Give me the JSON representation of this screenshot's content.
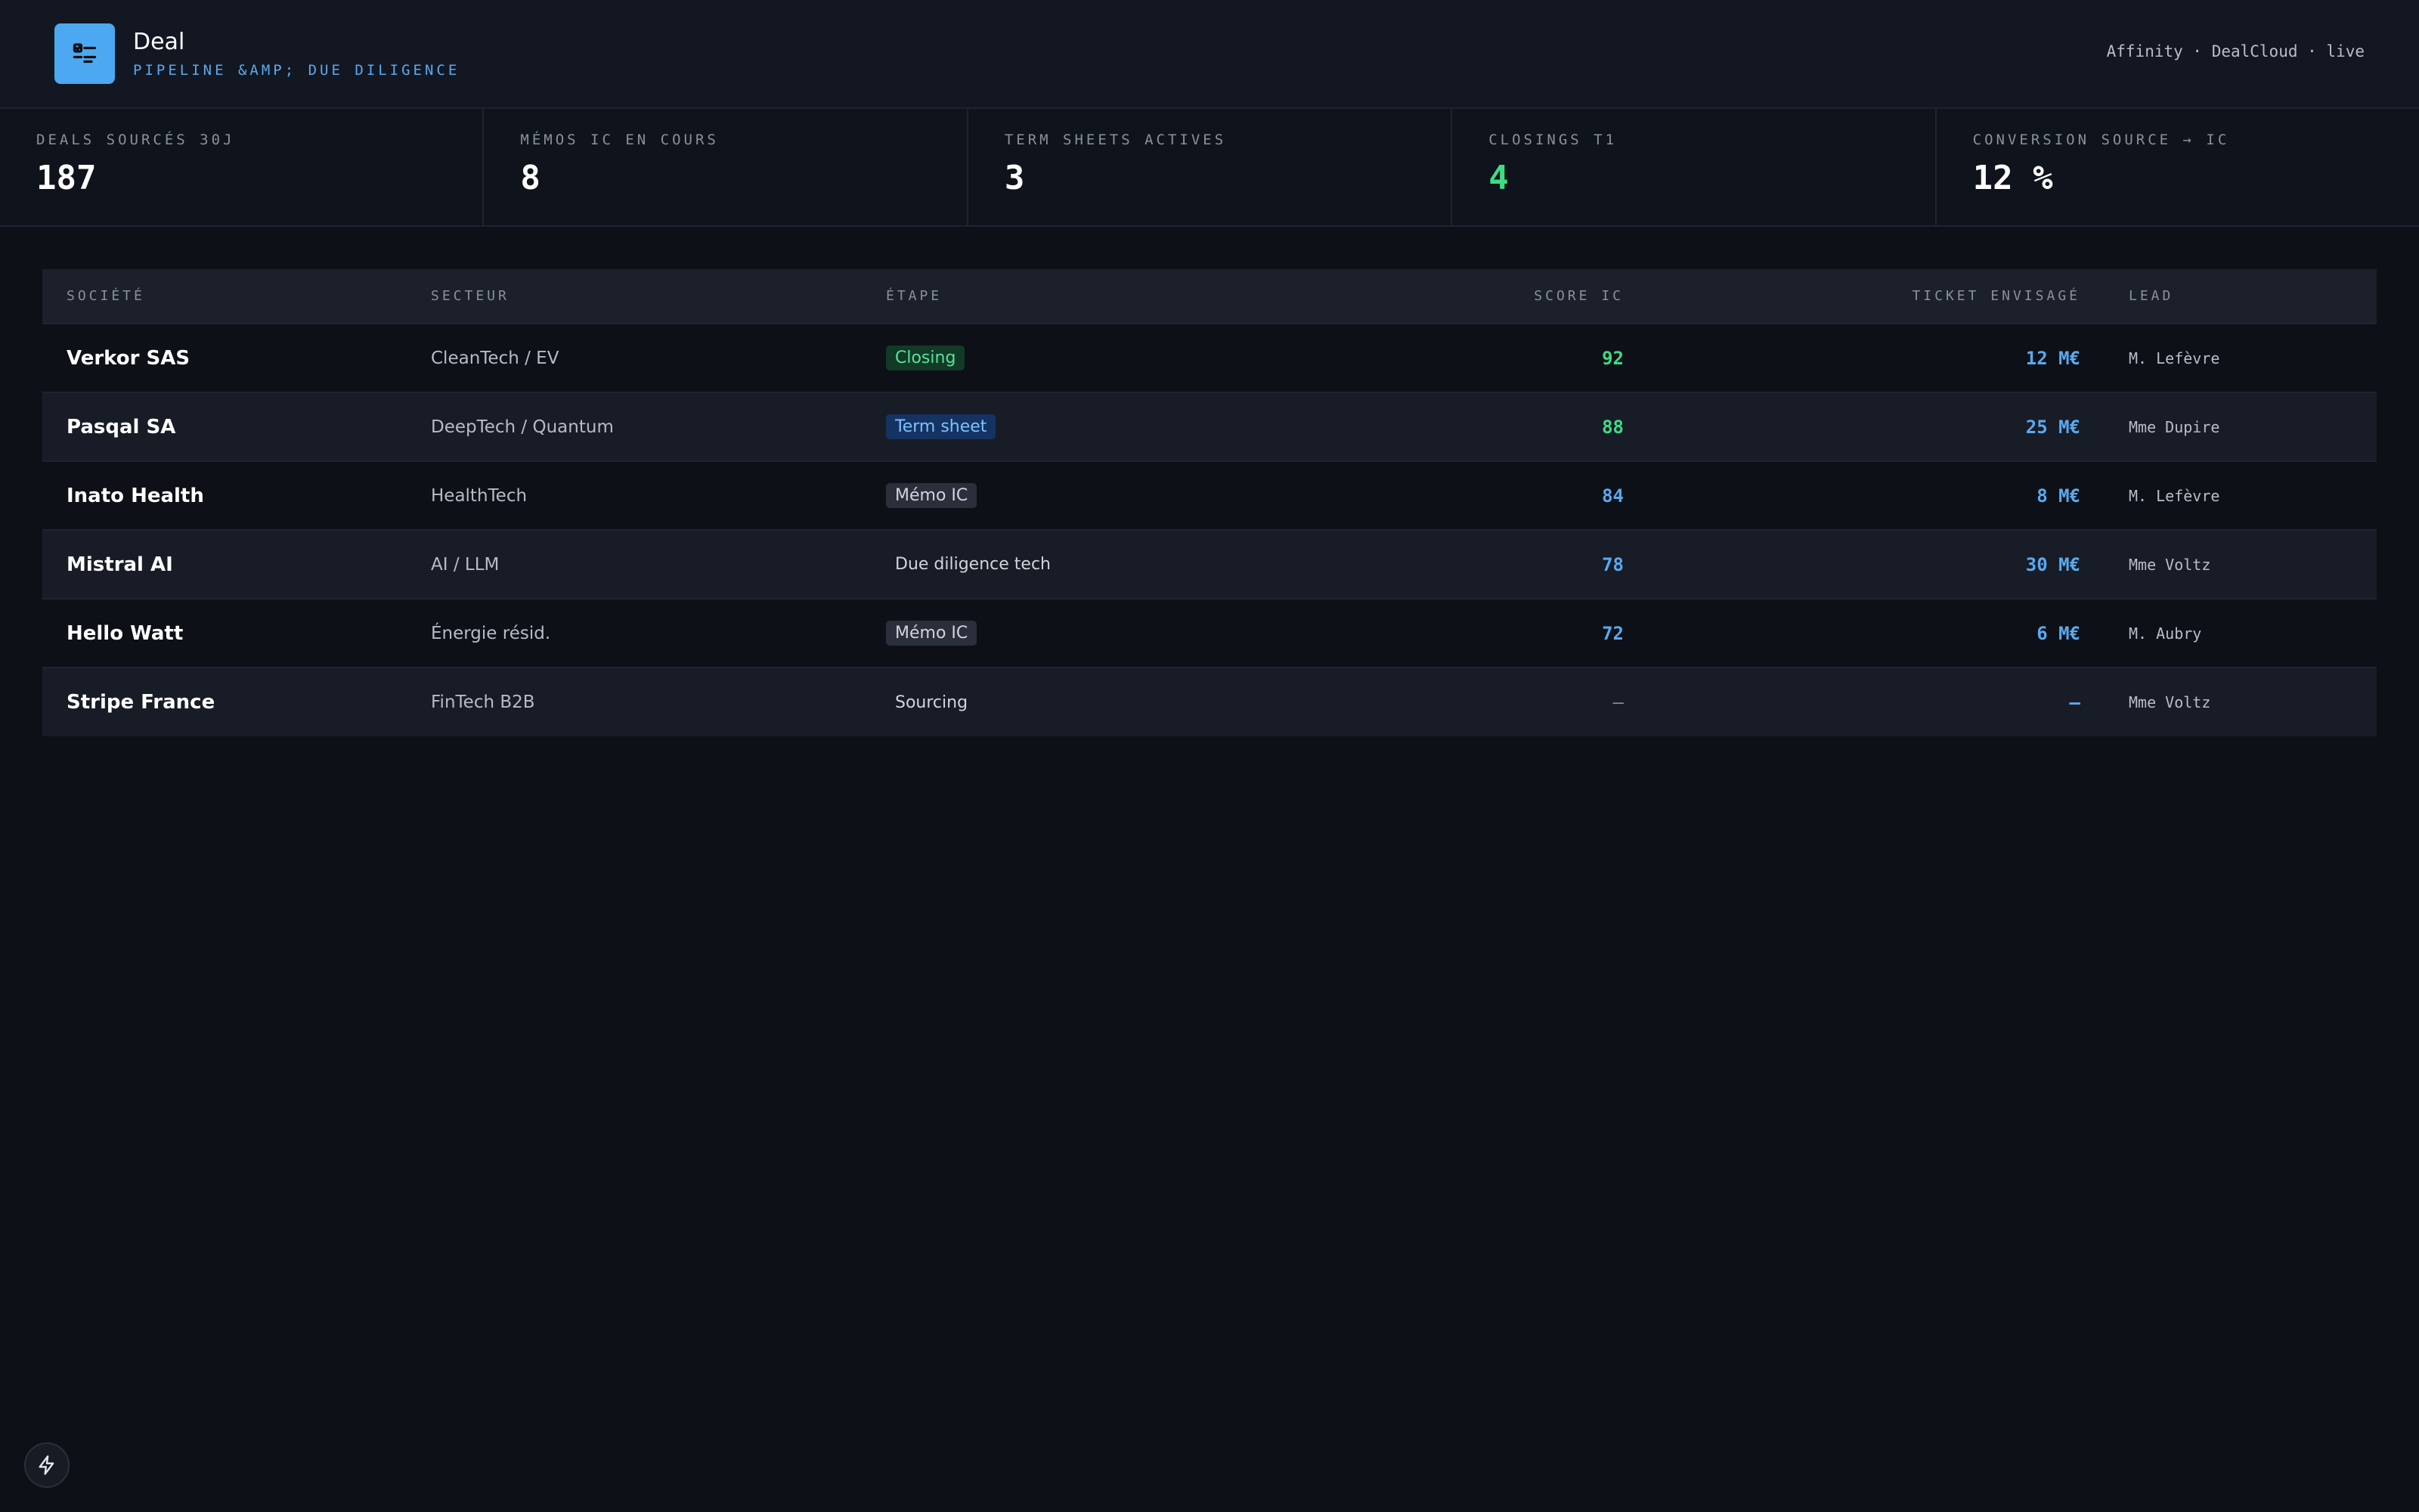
{
  "header": {
    "title": "Deal",
    "subtitle": "PIPELINE &AMP; DUE DILIGENCE",
    "right_text": "Affinity · DealCloud · live",
    "logo_icon": "checklist-icon"
  },
  "kpis": [
    {
      "label": "DEALS SOURCÉS 30J",
      "value": "187"
    },
    {
      "label": "MÉMOS IC EN COURS",
      "value": "8"
    },
    {
      "label": "TERM SHEETS ACTIVES",
      "value": "3"
    },
    {
      "label": "CLOSINGS T1",
      "value": "4",
      "color": "#3ddc84"
    },
    {
      "label": "CONVERSION SOURCE → IC",
      "value": "12 %"
    }
  ],
  "table": {
    "headers": [
      "SOCIÉTÉ",
      "SECTEUR",
      "ÉTAPE",
      "SCORE IC",
      "TICKET ENVISAGÉ",
      "LEAD"
    ],
    "rows": [
      {
        "company": "Verkor SAS",
        "sector": "CleanTech / EV",
        "stage": "Closing",
        "score": "92",
        "ticket": "12 M€",
        "lead": "M. Lefèvre"
      },
      {
        "company": "Pasqal SA",
        "sector": "DeepTech / Quantum",
        "stage": "Term sheet",
        "score": "88",
        "ticket": "25 M€",
        "lead": "Mme Dupire"
      },
      {
        "company": "Inato Health",
        "sector": "HealthTech",
        "stage": "Mémo IC",
        "score": "84",
        "ticket": "8 M€",
        "lead": "M. Lefèvre"
      },
      {
        "company": "Mistral AI",
        "sector": "AI / LLM",
        "stage": "Due diligence tech",
        "score": "78",
        "ticket": "30 M€",
        "lead": "Mme Voltz"
      },
      {
        "company": "Hello Watt",
        "sector": "Énergie résid.",
        "stage": "Mémo IC",
        "score": "72",
        "ticket": "6 M€",
        "lead": "M. Aubry"
      },
      {
        "company": "Stripe France",
        "sector": "FinTech B2B",
        "stage": "Sourcing",
        "score": "—",
        "ticket": "—",
        "lead": "Mme Voltz"
      }
    ]
  },
  "colors": {
    "accent": "#4ca8f0",
    "positive": "#3ddc84",
    "background": "#0d1017"
  },
  "footer": {
    "icon": "bolt-icon"
  }
}
